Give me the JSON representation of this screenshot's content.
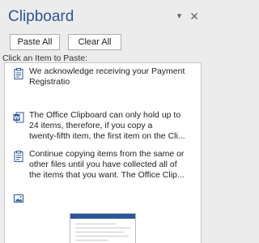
{
  "pane": {
    "title": "Clipboard",
    "options_glyph": "▾",
    "close_glyph": "✕"
  },
  "buttons": {
    "paste_all": "Paste All",
    "clear_all": "Clear All"
  },
  "instruction": "Click an Item to Paste:",
  "items": [
    {
      "text": "We acknowledge receiving your Payment\nRegistratio",
      "icon": "clipboard-text-icon"
    },
    {
      "text": "The Office Clipboard can only hold up to\n24 items, therefore, if you copy a\ntwenty-fifth item, the first item on the Cli...",
      "icon": "word-document-icon"
    },
    {
      "text": "Continue copying items from the same or\nother files until you have collected all of\nthe items that you want. The Office Clip...",
      "icon": "clipboard-text-icon"
    },
    {
      "text": "",
      "icon": "image-item-icon"
    }
  ]
}
